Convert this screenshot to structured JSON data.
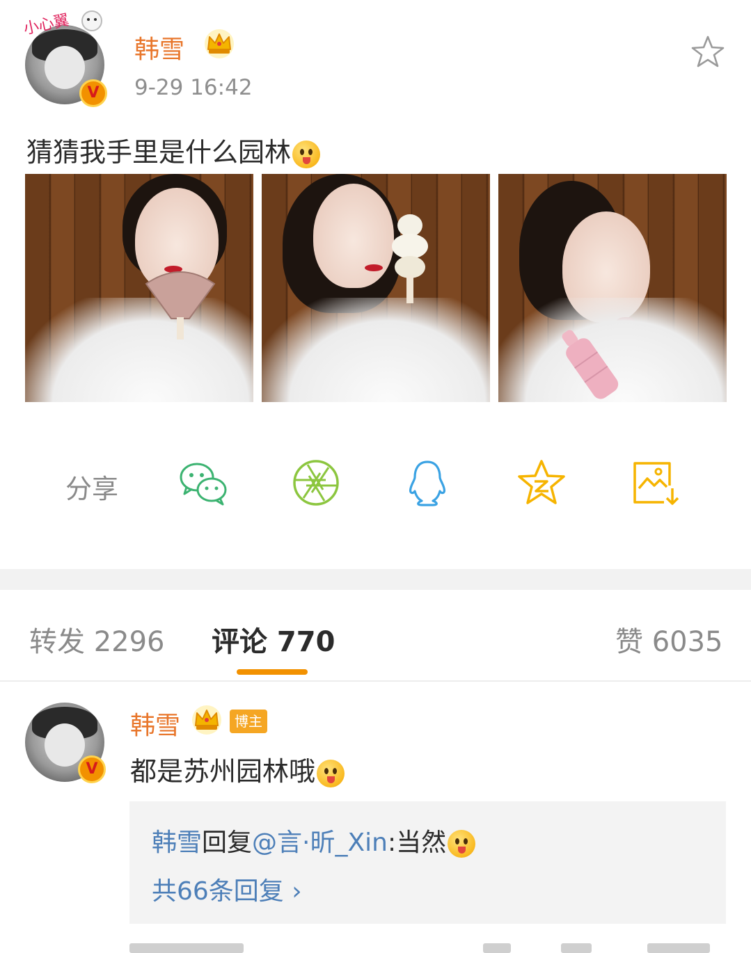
{
  "post": {
    "author": "韩雪",
    "timestamp": "9-29 16:42",
    "text": "猜猜我手里是什么园林",
    "sticker_text": "小心翼"
  },
  "share": {
    "label": "分享",
    "targets": [
      "wechat-icon",
      "moments-icon",
      "qq-icon",
      "qzone-icon",
      "save-image-icon"
    ]
  },
  "tabs": {
    "repost": "转发 2296",
    "comment": "评论 770",
    "like": "赞 6035"
  },
  "comment": {
    "author": "韩雪",
    "badge": "博主",
    "text": "都是苏州园林哦",
    "reply": {
      "author": "韩雪",
      "verb": "回复",
      "mention": "@言·昕_Xin",
      "colon_text": ":当然"
    },
    "reply_count": "共66条回复 ›"
  },
  "colors": {
    "username": "#e8762b",
    "link": "#4d7fb8",
    "accent": "#f29100"
  }
}
